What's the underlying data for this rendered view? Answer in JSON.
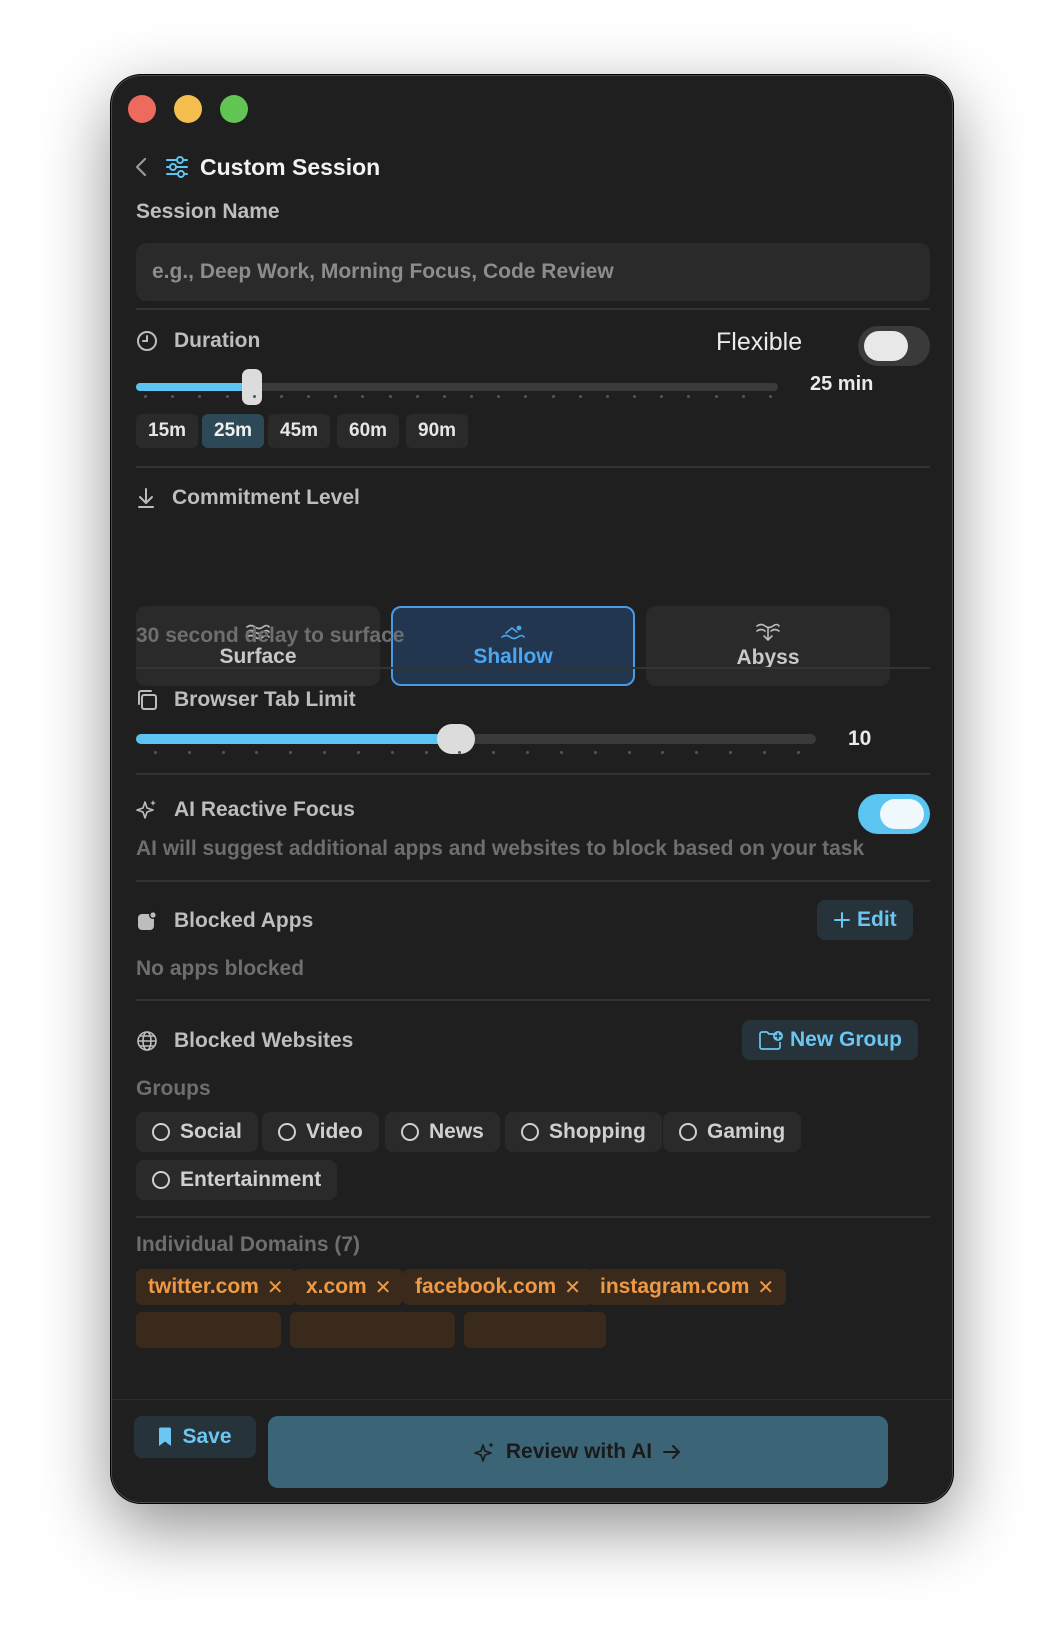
{
  "window": {
    "buttons": [
      "close",
      "minimize",
      "zoom"
    ]
  },
  "header": {
    "title": "Custom Session"
  },
  "session_name": {
    "label": "Session Name",
    "placeholder": "e.g., Deep Work, Morning Focus, Code Review",
    "value": ""
  },
  "duration": {
    "label": "Duration",
    "flexible_label": "Flexible",
    "flexible_on": false,
    "value_label": "25 min",
    "slider_fraction": 0.18,
    "presets": [
      "15m",
      "25m",
      "45m",
      "60m",
      "90m"
    ],
    "active_preset": "25m"
  },
  "commitment": {
    "label": "Commitment Level",
    "levels": [
      {
        "name": "Surface",
        "icon": "waves-icon"
      },
      {
        "name": "Shallow",
        "icon": "swimmer-icon"
      },
      {
        "name": "Abyss",
        "icon": "dive-icon"
      }
    ],
    "active": "Shallow",
    "description": "30 second delay to surface"
  },
  "tab_limit": {
    "label": "Browser Tab Limit",
    "value": "10",
    "slider_fraction": 0.47
  },
  "ai_focus": {
    "label": "AI Reactive Focus",
    "enabled": true,
    "description": "AI will suggest additional apps and websites to block based on your task"
  },
  "blocked_apps": {
    "label": "Blocked Apps",
    "edit_label": "Edit",
    "empty_text": "No apps blocked"
  },
  "blocked_websites": {
    "label": "Blocked Websites",
    "new_group_label": "New Group",
    "groups_label": "Groups",
    "groups": [
      "Social",
      "Video",
      "News",
      "Shopping",
      "Gaming",
      "Entertainment"
    ],
    "domains_label": "Individual Domains (7)",
    "domains": [
      "twitter.com",
      "x.com",
      "facebook.com",
      "instagram.com"
    ]
  },
  "footer": {
    "save_label": "Save",
    "review_label": "Review with AI"
  },
  "colors": {
    "accent": "#5bc4f0",
    "domain": "#ee9a45",
    "active_level": "#4aa6f0"
  }
}
